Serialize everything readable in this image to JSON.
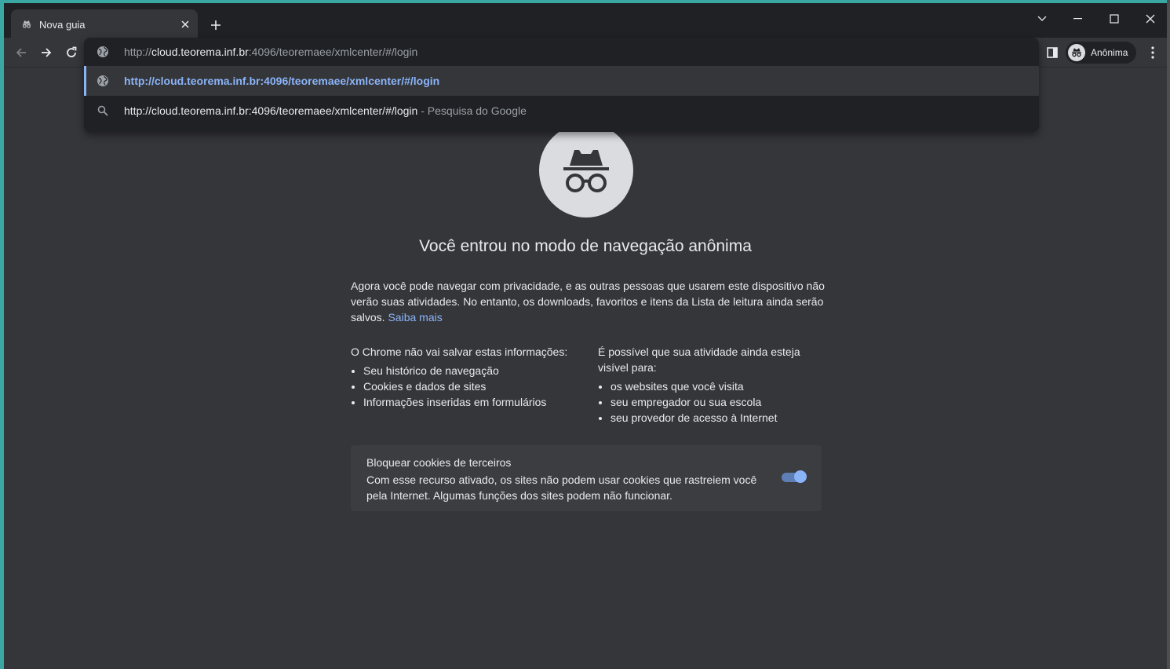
{
  "window": {
    "tab_title": "Nova guia",
    "new_tab_icon": "plus-icon",
    "controls": [
      "tab-search-icon",
      "minimize-icon",
      "maximize-icon",
      "close-icon"
    ]
  },
  "toolbar": {
    "profile_label": "Anônima"
  },
  "omnibox": {
    "input_scheme": "http://",
    "input_host": "cloud.teorema.inf.br",
    "input_rest": ":4096/teoremaee/xmlcenter/#/login",
    "suggestions": [
      {
        "icon": "globe-icon",
        "text": "http://cloud.teorema.inf.br:4096/teoremaee/xmlcenter/#/login",
        "selected": true
      },
      {
        "icon": "search-icon",
        "text": "http://cloud.teorema.inf.br:4096/teoremaee/xmlcenter/#/login",
        "separator": " - ",
        "source": "Pesquisa do Google"
      }
    ]
  },
  "page": {
    "heading": "Você entrou no modo de navegação anônima",
    "intro": "Agora você pode navegar com privacidade, e as outras pessoas que usarem este dispositivo não verão suas atividades. No entanto, os downloads, favoritos e itens da Lista de leitura ainda serão salvos.",
    "learn_more": "Saiba mais",
    "left_col": {
      "title": "O Chrome não vai salvar estas informações:",
      "items": [
        "Seu histórico de navegação",
        "Cookies e dados de sites",
        "Informações inseridas em formulários"
      ]
    },
    "right_col": {
      "title": "É possível que sua atividade ainda esteja visível para:",
      "items": [
        "os websites que você visita",
        "seu empregador ou sua escola",
        "seu provedor de acesso à Internet"
      ]
    },
    "cookie_card": {
      "title": "Bloquear cookies de terceiros",
      "description": "Com esse recurso ativado, os sites não podem usar cookies que rastreiem você pela Internet. Algumas funções dos sites podem não funcionar.",
      "toggle_on": true
    }
  },
  "colors": {
    "link": "#8ab4f8",
    "background": "#35363a",
    "frame": "#202124"
  }
}
